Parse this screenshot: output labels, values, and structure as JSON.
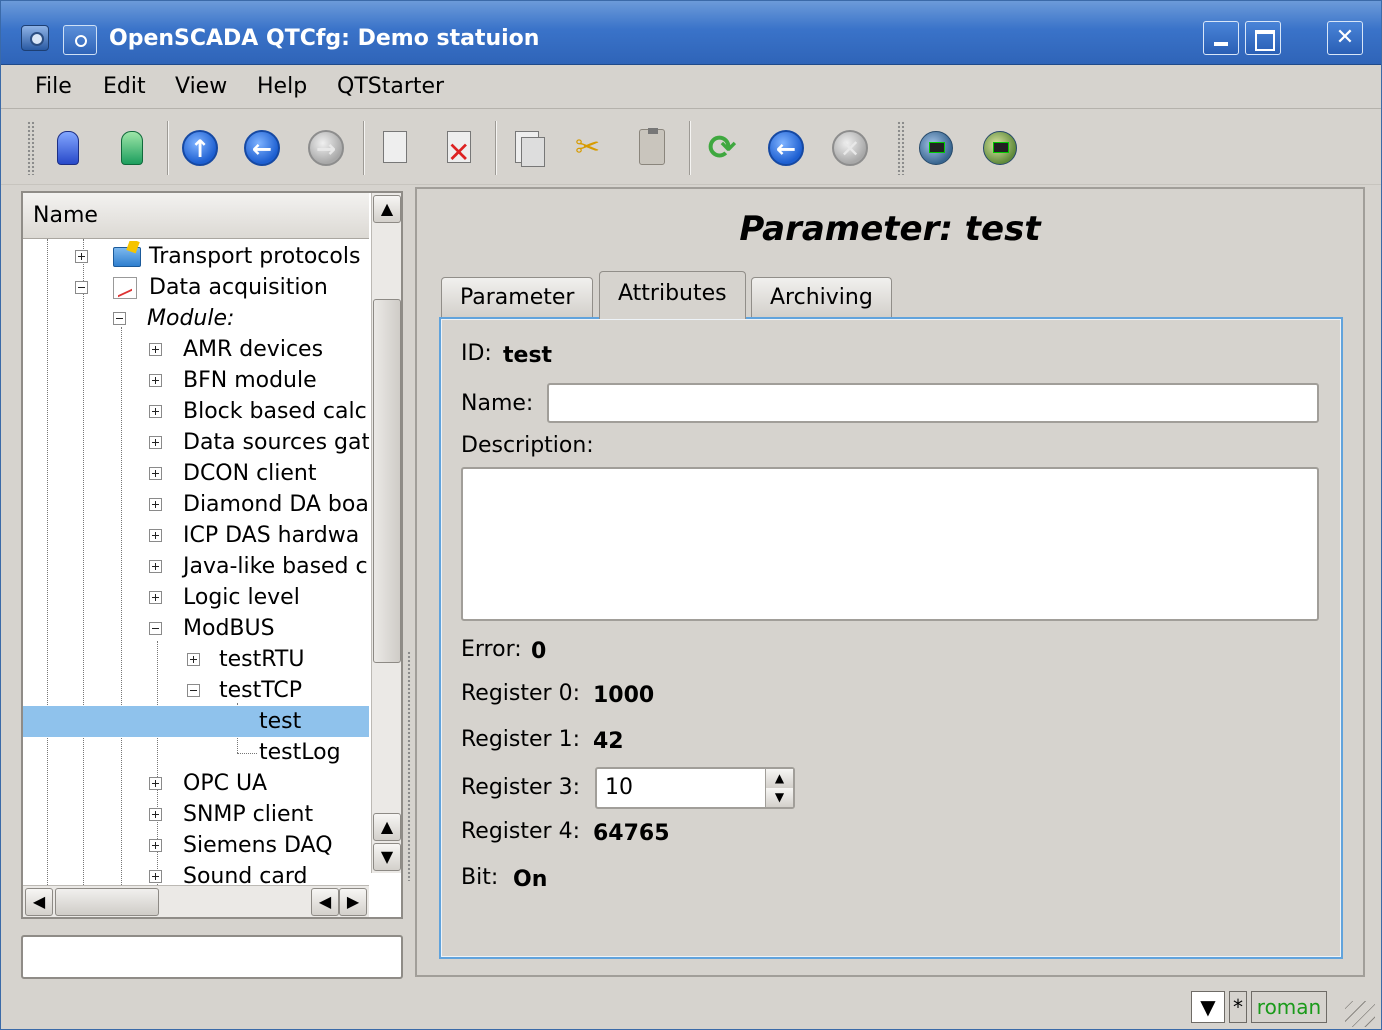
{
  "window": {
    "title": "OpenSCADA QTCfg: Demo statuion"
  },
  "menubar": {
    "items": [
      "File",
      "Edit",
      "View",
      "Help",
      "QTStarter"
    ]
  },
  "toolbar": {
    "buttons": [
      "db-load-icon",
      "db-save-icon",
      "up-icon",
      "back-icon",
      "forward-icon",
      "add-item-icon",
      "delete-item-icon",
      "copy-icon",
      "cut-icon",
      "paste-icon",
      "refresh-icon",
      "start-icon",
      "stop-icon",
      "manager-icon",
      "manager-alt-icon"
    ]
  },
  "tree": {
    "header": "Name",
    "rows": [
      {
        "label": "Transport protocols",
        "level": 1,
        "expander": "plus"
      },
      {
        "label": "Data acquisition",
        "level": 1,
        "expander": "minus"
      },
      {
        "label": "Module:",
        "level": 2,
        "expander": "minus"
      },
      {
        "label": "AMR devices",
        "level": 3,
        "expander": "plus"
      },
      {
        "label": "BFN module",
        "level": 3,
        "expander": "plus"
      },
      {
        "label": "Block based calc",
        "level": 3,
        "expander": "plus"
      },
      {
        "label": "Data sources gat",
        "level": 3,
        "expander": "plus"
      },
      {
        "label": "DCON client",
        "level": 3,
        "expander": "plus"
      },
      {
        "label": "Diamond DA boa",
        "level": 3,
        "expander": "plus"
      },
      {
        "label": "ICP DAS hardwa",
        "level": 3,
        "expander": "plus"
      },
      {
        "label": "Java-like based c",
        "level": 3,
        "expander": "plus"
      },
      {
        "label": "Logic level",
        "level": 3,
        "expander": "plus"
      },
      {
        "label": "ModBUS",
        "level": 3,
        "expander": "minus"
      },
      {
        "label": "testRTU",
        "level": 4,
        "expander": "plus"
      },
      {
        "label": "testTCP",
        "level": 4,
        "expander": "minus"
      },
      {
        "label": "test",
        "level": 5,
        "expander": "none",
        "selected": true
      },
      {
        "label": "testLog",
        "level": 5,
        "expander": "none"
      },
      {
        "label": "OPC UA",
        "level": 3,
        "expander": "plus"
      },
      {
        "label": "SNMP client",
        "level": 3,
        "expander": "plus"
      },
      {
        "label": "Siemens DAQ",
        "level": 3,
        "expander": "plus"
      },
      {
        "label": "Sound card",
        "level": 3,
        "expander": "plus"
      }
    ]
  },
  "status_input": {
    "value": ""
  },
  "panel": {
    "title": "Parameter: test",
    "tabs": [
      "Parameter",
      "Attributes",
      "Archiving"
    ],
    "active_tab": "Attributes",
    "fields": {
      "id_label": "ID:",
      "id_value": "test",
      "name_label": "Name:",
      "name_value": "",
      "description_label": "Description:",
      "description_value": "",
      "error_label": "Error:",
      "error_value": "0",
      "reg0_label": "Register 0:",
      "reg0_value": "1000",
      "reg1_label": "Register 1:",
      "reg1_value": "42",
      "reg3_label": "Register 3:",
      "reg3_value": "10",
      "reg4_label": "Register 4:",
      "reg4_value": "64765",
      "bit_label": "Bit:",
      "bit_value": "On"
    }
  },
  "statusbar": {
    "star": "*",
    "user": "roman",
    "user_color": "#1a9a1a"
  }
}
